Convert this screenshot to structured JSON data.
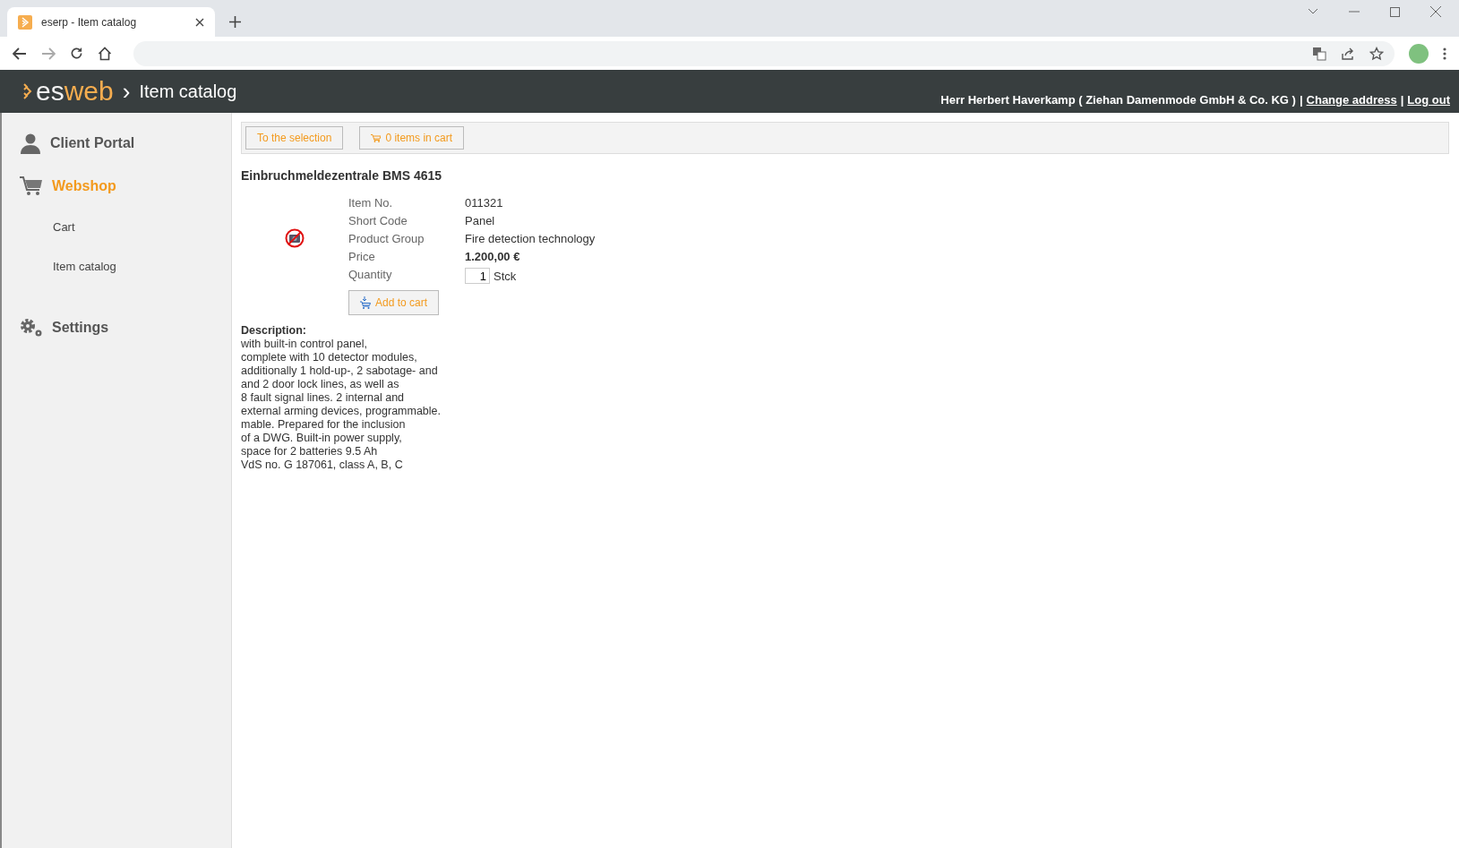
{
  "browser": {
    "tab_title": "eserp - Item catalog"
  },
  "header": {
    "logo_es": "es",
    "logo_web": "web",
    "separator": "›",
    "page_title": "Item catalog",
    "user": "Herr Herbert Haverkamp ( Ziehan Damenmode GmbH & Co. KG )",
    "sep1": "|",
    "change_address": "Change address",
    "sep2": "|",
    "log_out": "Log out"
  },
  "sidebar": {
    "items": [
      {
        "label": "Client Portal",
        "kind": "section",
        "selected": false
      },
      {
        "label": "Webshop",
        "kind": "section",
        "selected": true
      },
      {
        "label": "Cart",
        "kind": "subitem",
        "selected": false
      },
      {
        "label": "Item catalog",
        "kind": "subitem",
        "selected": false
      },
      {
        "label": "Settings",
        "kind": "section",
        "selected": false
      }
    ]
  },
  "toolbar": {
    "back_button": "To the selection",
    "cart_button": "0 items in cart"
  },
  "product": {
    "title": "Einbruchmeldezentrale BMS 4615",
    "fields": [
      {
        "label": "Item No.",
        "kind": "text",
        "value": "011321"
      },
      {
        "label": "Short Code",
        "kind": "text",
        "value": "Panel"
      },
      {
        "label": "Product Group",
        "kind": "text",
        "value": "Fire detection technology"
      },
      {
        "label": "Price",
        "kind": "bold",
        "value": "1.200,00 €"
      },
      {
        "label": "Quantity",
        "kind": "quantity",
        "value": "1",
        "unit": "Stck"
      }
    ],
    "add_button": "Add to cart",
    "description_label": "Description:",
    "description_lines": [
      "with built-in control panel,",
      "complete with 10 detector modules,",
      "additionally 1 hold-up-, 2 sabotage- and",
      "and 2 door lock lines, as well as",
      "8 fault signal lines. 2 internal and",
      "external arming devices, programmable.",
      "mable. Prepared for the inclusion",
      "of a DWG. Built-in power supply,",
      "space for 2 batteries 9.5 Ah",
      "VdS no. G 187061, class A, B, C"
    ]
  }
}
